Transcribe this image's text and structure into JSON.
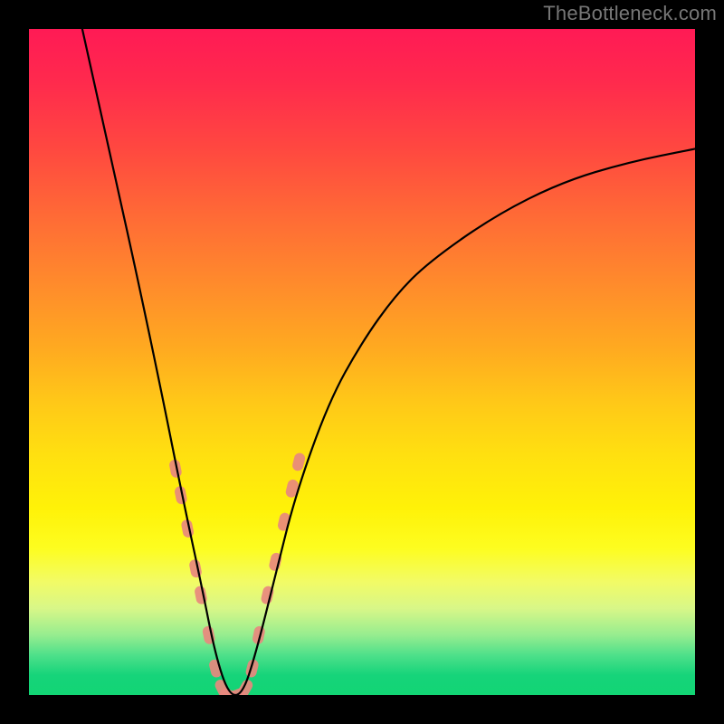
{
  "watermark": "TheBottleneck.com",
  "colors": {
    "frame": "#000000",
    "gradient_stops": [
      "#ff1a55",
      "#ff2a4d",
      "#ff4840",
      "#ff6a36",
      "#ff8a2c",
      "#ffaa20",
      "#ffc818",
      "#ffe010",
      "#fff208",
      "#fdfd20",
      "#f2fb66",
      "#d8f788",
      "#96ed8f",
      "#4ee08a",
      "#16d47a",
      "#12d574"
    ],
    "curve": "#000000",
    "marker": "#e8887e"
  },
  "chart_data": {
    "type": "line",
    "title": "",
    "xlabel": "",
    "ylabel": "",
    "xlim": [
      0,
      100
    ],
    "ylim": [
      0,
      100
    ],
    "description": "V-shaped bottleneck curve. y represents bottleneck percentage (0 at bottom / green = no bottleneck, 100 at top / red = severe bottleneck). The minimum sits near x≈30 where y≈0. Pink rounded markers highlight the near-optimal band around the trough.",
    "series": [
      {
        "name": "bottleneck-curve",
        "x": [
          8,
          12,
          16,
          20,
          23,
          26,
          28,
          30,
          32,
          34,
          37,
          40,
          45,
          50,
          55,
          60,
          70,
          80,
          90,
          100
        ],
        "y": [
          100,
          82,
          64,
          45,
          30,
          16,
          6,
          0,
          0,
          6,
          18,
          30,
          44,
          53,
          60,
          65,
          72,
          77,
          80,
          82
        ]
      }
    ],
    "markers": {
      "name": "optimal-band",
      "comment": "Clusters of pink capsule markers along both walls of the V near the bottom.",
      "points": [
        {
          "x": 22.0,
          "y": 34
        },
        {
          "x": 22.8,
          "y": 30
        },
        {
          "x": 23.8,
          "y": 25
        },
        {
          "x": 25.0,
          "y": 19
        },
        {
          "x": 25.8,
          "y": 15
        },
        {
          "x": 27.0,
          "y": 9
        },
        {
          "x": 28.0,
          "y": 4
        },
        {
          "x": 29.0,
          "y": 1
        },
        {
          "x": 30.0,
          "y": 0
        },
        {
          "x": 31.2,
          "y": 0
        },
        {
          "x": 32.5,
          "y": 1
        },
        {
          "x": 33.5,
          "y": 4
        },
        {
          "x": 34.5,
          "y": 9
        },
        {
          "x": 35.8,
          "y": 15
        },
        {
          "x": 37.0,
          "y": 20
        },
        {
          "x": 38.3,
          "y": 26
        },
        {
          "x": 39.5,
          "y": 31
        },
        {
          "x": 40.5,
          "y": 35
        }
      ]
    }
  }
}
